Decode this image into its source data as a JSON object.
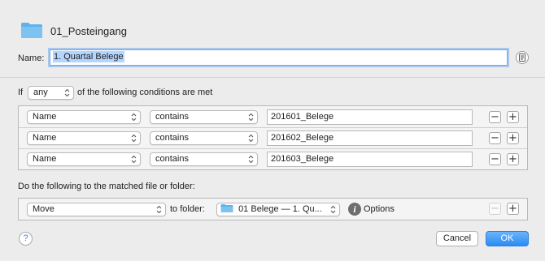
{
  "header": {
    "folder_icon": "folder-icon",
    "folder_name": "01_Posteingang"
  },
  "name_field": {
    "label": "Name:",
    "value": "1. Quartal Belege",
    "action_icon": "notes-icon"
  },
  "conditions": {
    "prefix": "If",
    "match_value": "any",
    "suffix": "of the following conditions are met",
    "rows": [
      {
        "attribute": "Name",
        "operator": "contains",
        "value": "201601_Belege"
      },
      {
        "attribute": "Name",
        "operator": "contains",
        "value": "201602_Belege"
      },
      {
        "attribute": "Name",
        "operator": "contains",
        "value": "201603_Belege"
      }
    ],
    "remove_label": "−",
    "add_label": "+"
  },
  "actions": {
    "heading": "Do the following to the matched file or folder:",
    "action_value": "Move",
    "to_folder_label": "to folder:",
    "folder_value": "01 Belege — 1. Qu...",
    "options_label": "Options",
    "remove_label": "−",
    "add_label": "+"
  },
  "footer": {
    "help_label": "?",
    "cancel_label": "Cancel",
    "ok_label": "OK"
  },
  "colors": {
    "background": "#ececec",
    "accent": "#2a8cf4",
    "folder_blue": "#5fb2ea"
  }
}
